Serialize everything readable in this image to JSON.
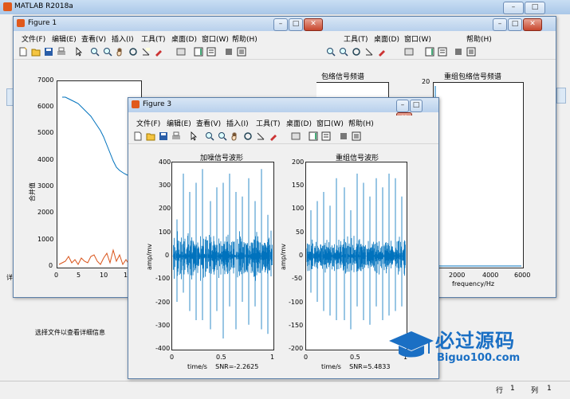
{
  "app": {
    "title": "MATLAB R2018a"
  },
  "figure_menu": [
    "文件(F)",
    "编辑(E)",
    "查看(V)",
    "插入(I)",
    "工具(T)",
    "桌面(D)",
    "窗口(W)",
    "帮助(H)"
  ],
  "figure1": {
    "title": "Figure 1",
    "ylabel": "合并值",
    "yticks": [
      "7000",
      "6000",
      "5000",
      "4000",
      "3000",
      "2000",
      "1000",
      "0"
    ],
    "xticks": [
      "0",
      "5",
      "10",
      "1"
    ],
    "right_plot1_title": "包络信号频谱",
    "right_plot2_title": "重组包络信号频谱",
    "right_plot2_ytick": "20",
    "right_plot2_xticks": [
      "2000",
      "4000",
      "6000"
    ],
    "right_plot2_xlabel": "frequency/Hz"
  },
  "figure3": {
    "title": "Figure 3",
    "left_title": "加噪信号波形",
    "right_title": "重组信号波形",
    "left_yticks": [
      "400",
      "300",
      "200",
      "100",
      "0",
      "-100",
      "-200",
      "-300",
      "-400"
    ],
    "right_yticks": [
      "200",
      "150",
      "100",
      "50",
      "0",
      "-50",
      "-100",
      "-150",
      "-200"
    ],
    "xticks": [
      "0",
      "0.5",
      "1"
    ],
    "ylabel": "amp/mv",
    "left_xlabel": "time/s    SNR=-2.2625",
    "right_xlabel": "time/s    SNR=5.4833"
  },
  "main": {
    "hint": "选择文件以查看详细信息",
    "side_letter": "详"
  },
  "status": {
    "row_label": "行",
    "row_value": "1",
    "col_label": "列",
    "col_value": "1"
  },
  "watermark": {
    "text": "必过源码",
    "url": "Biguo100.com"
  },
  "colors": {
    "series_blue": "#0072bd",
    "series_orange": "#d95319",
    "accent": "#1a6fc4"
  },
  "icons": [
    "new-file-icon",
    "open-folder-icon",
    "save-icon",
    "print-icon",
    "pointer-icon",
    "zoom-in-icon",
    "zoom-out-icon",
    "pan-icon",
    "rotate-icon",
    "data-cursor-icon",
    "brush-icon",
    "link-icon",
    "colorbar-icon",
    "legend-icon",
    "hide-tools-icon",
    "show-tools-icon"
  ]
}
